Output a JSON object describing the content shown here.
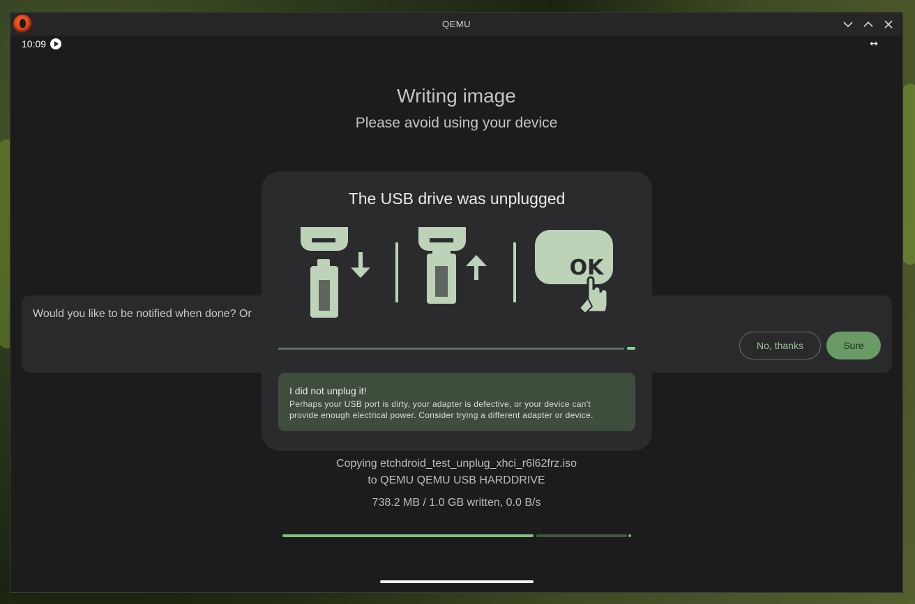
{
  "window": {
    "title": "QEMU",
    "controls": [
      "minimize",
      "maximize",
      "close"
    ]
  },
  "statusbar": {
    "time": "10:09",
    "status_icon": "play-icon",
    "resize_icon": "↔"
  },
  "main": {
    "title": "Writing image",
    "subtitle": "Please avoid using your device"
  },
  "notify_card": {
    "text": "Would you like to be notified when done? Or",
    "decline_label": "No, thanks",
    "accept_label": "Sure"
  },
  "dialog": {
    "title": "The USB drive was unplugged",
    "illustration": {
      "ok_label": "OK",
      "icons": [
        "usb-unplug-icon",
        "usb-plug-icon",
        "tap-ok-icon"
      ]
    },
    "info_title": "I did not unplug it!",
    "info_body_line1": "Perhaps your USB port is dirty, your adapter is defective, or your device can't",
    "info_body_line2": "provide enough electrical power. Consider trying a different adapter or device."
  },
  "copy": {
    "line1": "Copying  etchdroid_test_unplug_xhci_r6l62frz.iso",
    "line2": "to QEMU QEMU USB HARDDRIVE",
    "stats": "738.2 MB / 1.0 GB written, 0.0 B/s",
    "progress": 0.72
  },
  "colors": {
    "accent": "#7fc07a",
    "button_filled": "#6a9a66",
    "illustration": "#bcd3b8",
    "info_bg": "#3f4d3d"
  }
}
